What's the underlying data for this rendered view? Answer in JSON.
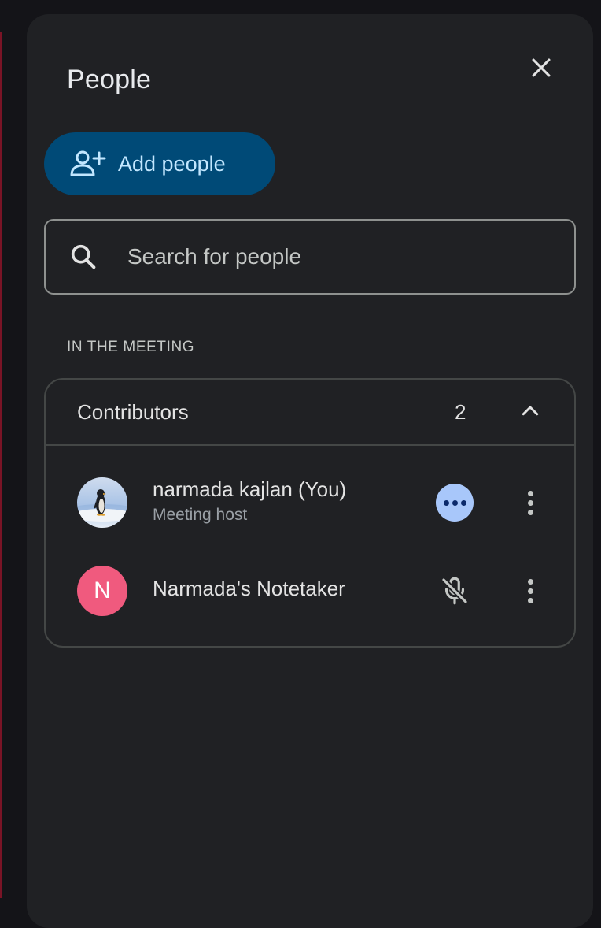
{
  "panel": {
    "title": "People",
    "close_icon": "close-icon"
  },
  "add_people": {
    "label": "Add people",
    "icon": "person-add-icon"
  },
  "search": {
    "placeholder": "Search for people",
    "value": "",
    "icon": "search-icon"
  },
  "section": {
    "label": "IN THE MEETING"
  },
  "contributors": {
    "title": "Contributors",
    "count": "2",
    "expanded": true,
    "people": [
      {
        "name": "narmada kajlan (You)",
        "role": "Meeting host",
        "avatar": "penguin-avatar-image",
        "status": "speaking-indicator-icon"
      },
      {
        "name": "Narmada's Notetaker",
        "avatar_letter": "N",
        "avatar_color": "#f05a7e",
        "status": "mic-off-icon"
      }
    ]
  },
  "colors": {
    "panel_bg": "#202124",
    "accent_button_bg": "#004a77",
    "accent_button_text": "#c2e7ff",
    "speaking_indicator": "#a8c7fa"
  }
}
